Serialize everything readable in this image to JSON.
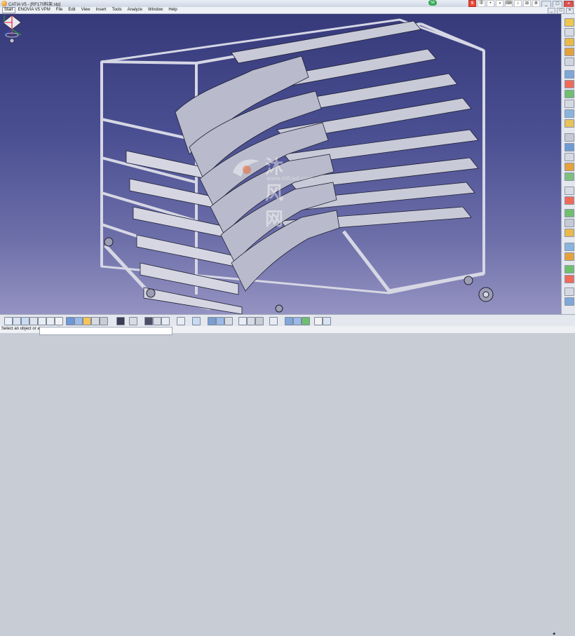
{
  "window": {
    "title": "CATIA V5 - [RF170料架.stp]",
    "controls": [
      "_",
      "□",
      "×"
    ]
  },
  "net_badge": "58",
  "ime_toolbar": [
    "S",
    "中",
    "•",
    "◑",
    "⌨",
    "♪",
    "⊞",
    "⚙"
  ],
  "menubar": {
    "start": "Start",
    "items": [
      "ENOVIA V5 VPM",
      "File",
      "Edit",
      "View",
      "Insert",
      "Tools",
      "Analyze",
      "Window",
      "Help"
    ],
    "doc_controls": [
      "_",
      "□",
      "×"
    ]
  },
  "watermark": {
    "text": "沐风网",
    "url": "www.mfcad.com"
  },
  "status": {
    "message": "Select an object or a command",
    "command_input": ""
  },
  "icons": {
    "compass": "compass-icon",
    "axis": "axis-triad-icon",
    "brand": "catia-logo"
  },
  "colors": {
    "viewport_top": "#363a7a",
    "viewport_bottom": "#9493c2",
    "model_fill": "#c9cad8",
    "model_edge": "#1d1f33"
  }
}
